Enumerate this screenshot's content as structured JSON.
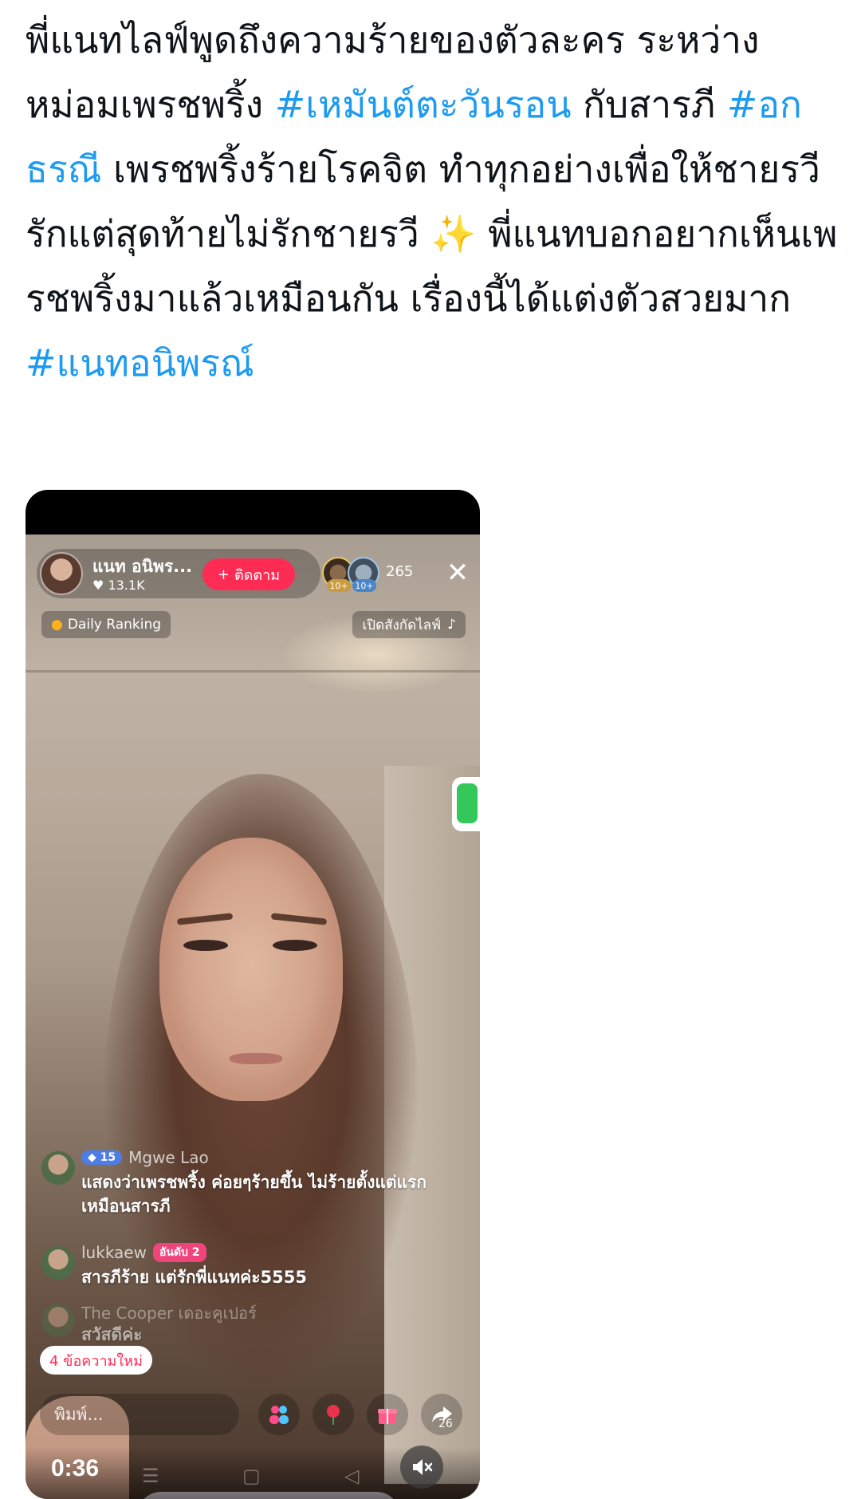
{
  "tweet": {
    "segments": [
      {
        "type": "text",
        "text": "พี่แนทไลฟ์พูดถึงความร้ายของตัวละคร ระหว่าง หม่อมเพรชพริ้ง "
      },
      {
        "type": "hashtag",
        "text": "#เหมันต์ตะวันรอน"
      },
      {
        "type": "text",
        "text": " กับสารภี "
      },
      {
        "type": "hashtag",
        "text": "#อกธรณี"
      },
      {
        "type": "text",
        "text": " เพรชพริ้งร้ายโรคจิต ทำทุกอย่างเพื่อให้ชายรวีรักแต่สุดท้ายไม่รักชายรวี ✨ พี่แนทบอกอยากเห็นเพรชพริ้งมาแล้วเหมือนกัน เรื่องนี้ได้แต่งตัวสวยมาก "
      },
      {
        "type": "hashtag",
        "text": "#แนทอนิพรณ์"
      }
    ]
  },
  "colors": {
    "text": "#0f1419",
    "hashtag": "#1d9bf0",
    "follow": "#fe2c55"
  },
  "live": {
    "host_name": "แนท อนิพร...",
    "host_likes": "13.1K",
    "follow_label": "ติดตาม",
    "viewer_badges": [
      "10+",
      "10+"
    ],
    "viewer_count": "265",
    "ranking_label": "Daily Ranking",
    "open_live_label": "เปิดสังกัดไลฟ์",
    "comments": [
      {
        "level": "15",
        "user": "Mgwe Lao",
        "rank": "",
        "text": "แสดงว่าเพรชพริ้ง ค่อยๆร้ายขึ้น ไม่ร้ายตั้งแต่แรกเหมือนสารภี"
      },
      {
        "level": "",
        "user": "lukkaew",
        "rank": "อันดับ 2",
        "text": "สารภีร้าย แต่รักพี่แนทค่ะ5555"
      },
      {
        "level": "",
        "user": "The Cooper เดอะคูเปอร์",
        "rank": "",
        "text": "สวัสดีค่ะ"
      }
    ],
    "new_messages_label": "4 ข้อความใหม่",
    "input_placeholder": "พิมพ์...",
    "share_count": "26"
  },
  "player": {
    "timecode": "0:36"
  },
  "icons": [
    "close-icon",
    "heart-icon",
    "fire-icon",
    "tiktok-icon",
    "people-icon",
    "rose-icon",
    "gift-icon",
    "share-icon",
    "mute-icon"
  ]
}
